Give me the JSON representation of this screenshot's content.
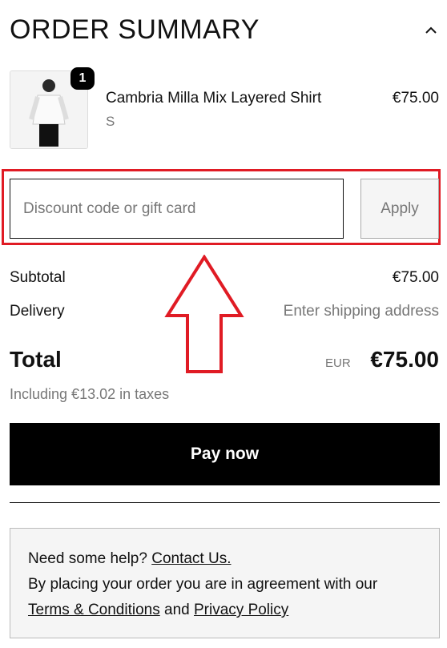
{
  "header": {
    "title": "ORDER SUMMARY",
    "toggle_icon": "chevron-up-icon"
  },
  "item": {
    "quantity": "1",
    "name": "Cambria Milla Mix Layered Shirt",
    "variant": "S",
    "price": "€75.00"
  },
  "discount": {
    "placeholder": "Discount code or gift card",
    "value": "",
    "apply_label": "Apply"
  },
  "summary": {
    "subtotal_label": "Subtotal",
    "subtotal_value": "€75.00",
    "delivery_label": "Delivery",
    "delivery_value": "Enter shipping address",
    "total_label": "Total",
    "total_currency": "EUR",
    "total_value": "€75.00",
    "taxes_note": "Including €13.02 in taxes"
  },
  "pay_label": "Pay now",
  "help": {
    "prefix": "Need some help? ",
    "contact_link": "Contact Us.",
    "agreement_text": "By placing your order you are in agreement with our",
    "terms_link": "Terms & Conditions",
    "and_text": " and ",
    "privacy_link": "Privacy Policy"
  },
  "colors": {
    "highlight": "#e01b24",
    "primary_button": "#000000",
    "muted_text": "#777777"
  }
}
